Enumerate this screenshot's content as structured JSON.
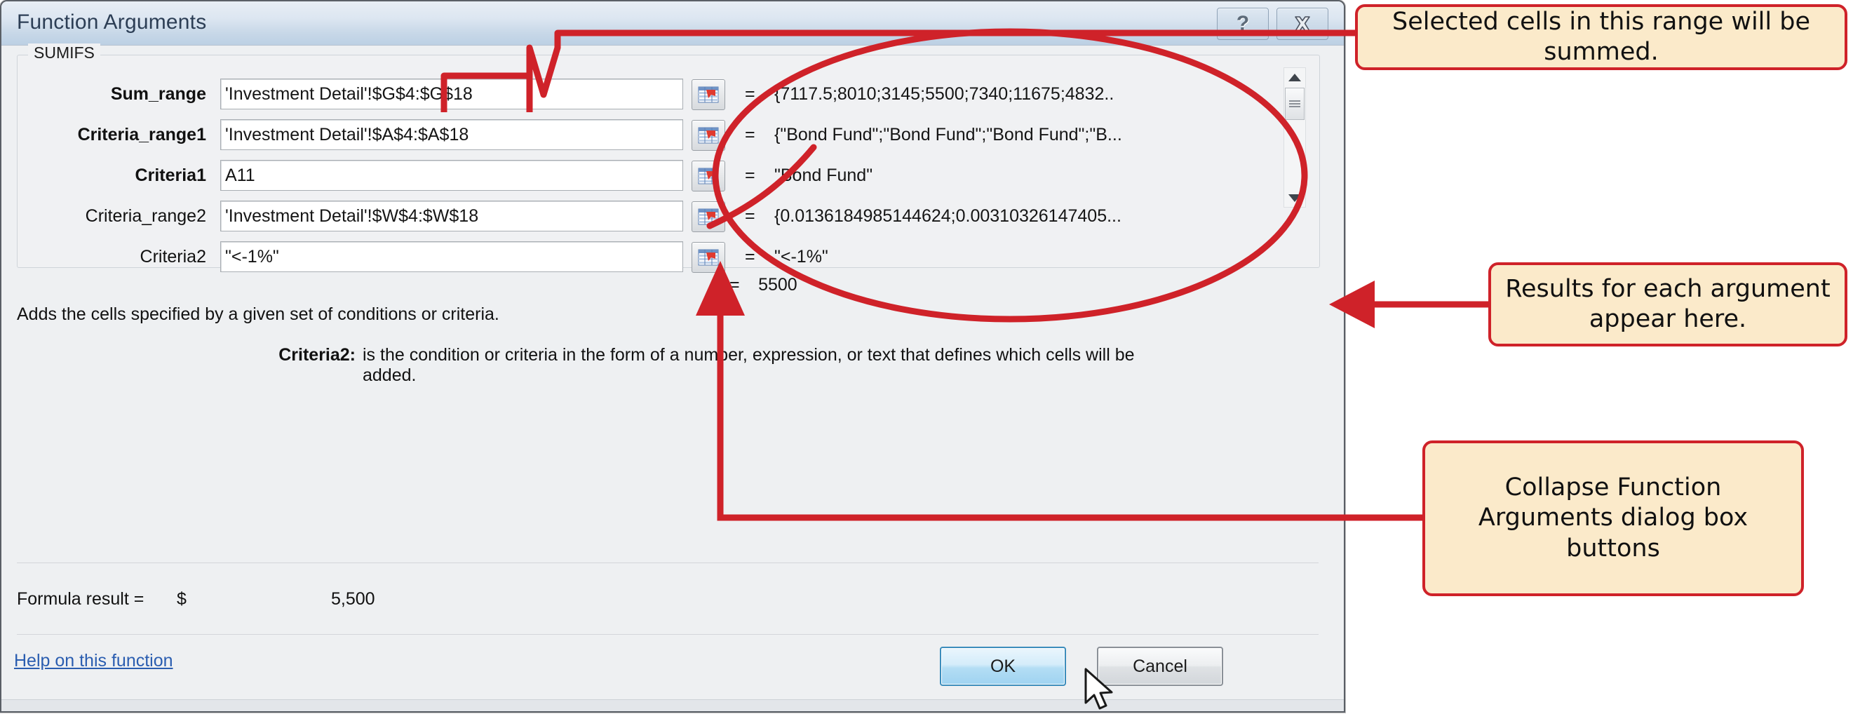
{
  "dialog": {
    "title": "Function Arguments",
    "group_label": "SUMIFS",
    "help_button_icon": "question-mark-icon",
    "close_button_icon": "close-x-icon",
    "arguments": [
      {
        "label": "Sum_range",
        "bold": true,
        "value": "'Investment Detail'!$G$4:$G$18",
        "result": "{7117.5;8010;3145;5500;7340;11675;4832..",
        "equals": "=",
        "collapse_icon": "range-selector-icon"
      },
      {
        "label": "Criteria_range1",
        "bold": true,
        "value": "'Investment Detail'!$A$4:$A$18",
        "result": "{\"Bond Fund\";\"Bond Fund\";\"Bond Fund\";\"B...",
        "equals": "=",
        "collapse_icon": "range-selector-icon"
      },
      {
        "label": "Criteria1",
        "bold": true,
        "value": "A11",
        "result": "\"Bond Fund\"",
        "equals": "=",
        "collapse_icon": "range-selector-icon"
      },
      {
        "label": "Criteria_range2",
        "bold": false,
        "value": "'Investment Detail'!$W$4:$W$18",
        "result": "{0.0136184985144624;0.00310326147405...",
        "equals": "=",
        "collapse_icon": "range-selector-icon"
      },
      {
        "label": "Criteria2",
        "bold": false,
        "value": "\"<-1%\"",
        "result": "\"<-1%\"",
        "equals": "=",
        "collapse_icon": "range-selector-icon"
      }
    ],
    "final_equals": "=",
    "final_result": "5500",
    "description": "Adds the cells specified by a given set of conditions or criteria.",
    "arg_help_label": "Criteria2:",
    "arg_help_text": "is the condition or criteria in the form of a number, expression, or text that defines which cells will be added.",
    "formula_result_label": "Formula result =",
    "formula_result_currency": "$",
    "formula_result_value": "5,500",
    "help_link": "Help on this function",
    "ok_label": "OK",
    "cancel_label": "Cancel",
    "scrollbar": {
      "up_icon": "scroll-up-arrow-icon",
      "down_icon": "scroll-down-arrow-icon",
      "thumb_icon": "scrollbar-thumb"
    }
  },
  "annotations": [
    {
      "id": "selected-cells",
      "text": "Selected cells in this range will be summed."
    },
    {
      "id": "results-each-arg",
      "text": "Results for each argument appear here."
    },
    {
      "id": "collapse-buttons",
      "text": "Collapse Function Arguments dialog box buttons"
    }
  ],
  "colors": {
    "annotation_red": "#cf2229",
    "callout_fill": "#fbeaca",
    "title_text": "#2c3e55",
    "link_blue": "#2a5db0",
    "ok_border": "#3c8dbc"
  }
}
